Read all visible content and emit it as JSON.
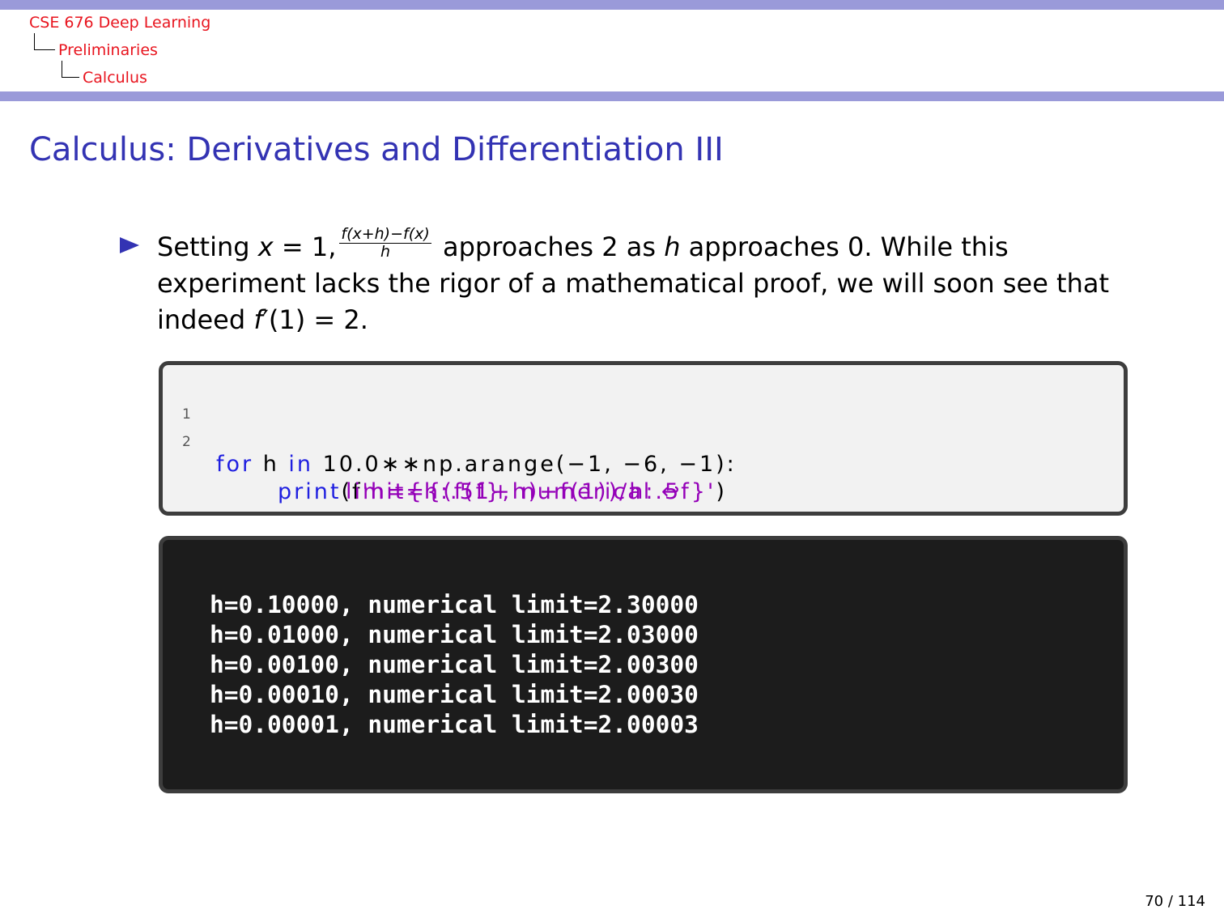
{
  "header": {
    "course": "CSE 676 Deep Learning",
    "section": "Preliminaries",
    "subsection": "Calculus",
    "accent_color": "#9a9ad9",
    "link_color": "#e8141e"
  },
  "frame": {
    "title": "Calculus: Derivatives and Differentiation III",
    "title_color": "#3333b3"
  },
  "bullet": {
    "setting": "Setting ",
    "x_var": "x",
    "eq_one": " = 1,",
    "frac_num": "f(x+h)−f(x)",
    "frac_den": "h",
    "approaches": " approaches 2 as ",
    "h_var": "h",
    "rest": " approaches 0. While this experiment lacks the rigor of a mathematical proof, we will soon see that indeed ",
    "f_var": "f",
    "prime_expr": "′(1) = 2."
  },
  "code": {
    "line1": {
      "num": "1",
      "kw_for": "for",
      "var_h": " h ",
      "kw_in": "in",
      "expr": " 10.0∗∗np.arange(−1, −6, −1):"
    },
    "line2": {
      "num": "2",
      "func": "print",
      "open": "(f",
      "str_a": "'h={h:.5f}, numerical",
      "arrow": "↩",
      "str_b": "limit={(f(1+h)−f(1))/h:.5f}",
      "str_c": "'",
      "close": ")"
    }
  },
  "output": {
    "lines": [
      "h=0.10000, numerical limit=2.30000",
      "h=0.01000, numerical limit=2.03000",
      "h=0.00100, numerical limit=2.00300",
      "h=0.00010, numerical limit=2.00030",
      "h=0.00001, numerical limit=2.00003"
    ]
  },
  "footer": {
    "page": "70 / 114"
  }
}
